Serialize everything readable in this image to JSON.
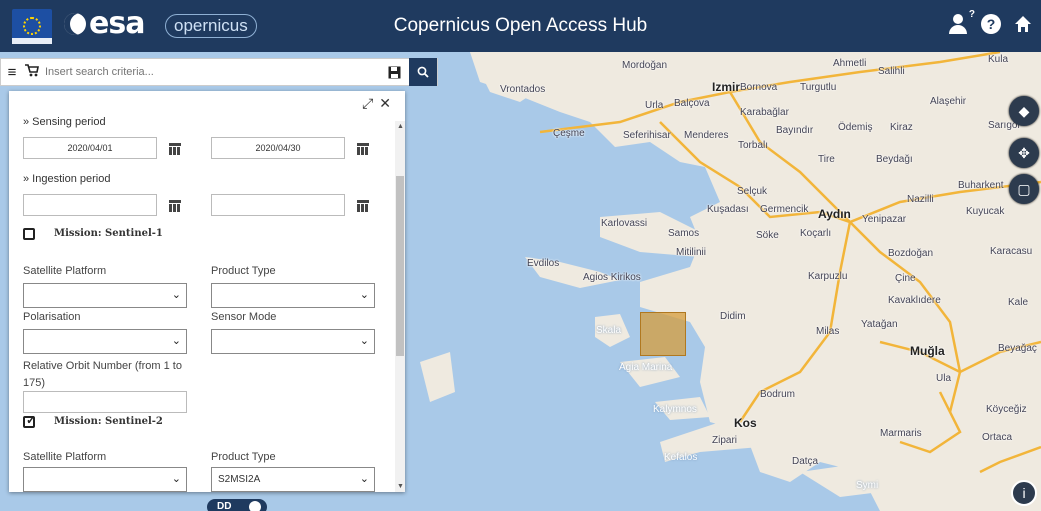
{
  "header": {
    "eu_logo": "eu-flag-icon",
    "esa_logo": "esa",
    "copernicus_logo": "opernicus",
    "title": "Copernicus Open Access Hub"
  },
  "search": {
    "placeholder": "Insert search criteria..."
  },
  "panel": {
    "sensing_period": {
      "label": "» Sensing period",
      "from": "2020/04/01",
      "to": "2020/04/30"
    },
    "ingestion_period": {
      "label": "» Ingestion period",
      "from": "",
      "to": ""
    },
    "sentinel1": {
      "label": "Mission: Sentinel-1",
      "checked": false,
      "satellite_platform_label": "Satellite Platform",
      "satellite_platform_value": "",
      "product_type_label": "Product Type",
      "product_type_value": "",
      "polarisation_label": "Polarisation",
      "polarisation_value": "",
      "sensor_mode_label": "Sensor Mode",
      "sensor_mode_value": "",
      "orbit_label": "Relative Orbit Number (from 1 to 175)",
      "orbit_value": ""
    },
    "sentinel2": {
      "label": "Mission: Sentinel-2",
      "checked": true,
      "satellite_platform_label": "Satellite Platform",
      "satellite_platform_value": "",
      "product_type_label": "Product Type",
      "product_type_value": "S2MSI2A"
    }
  },
  "toggle": {
    "label": "DD"
  },
  "map": {
    "labels": {
      "izmir": "Izmir",
      "bornova": "Bornova",
      "karabaglar": "Karabağlar",
      "mordogan": "Mordoğan",
      "vrontados": "Vrontados",
      "cesme": "Çeşme",
      "urla": "Urla",
      "balcova": "Balçova",
      "seferihisar": "Seferihisar",
      "menderes": "Menderes",
      "torbali": "Torbalı",
      "turgutlu": "Turgutlu",
      "ahmetli": "Ahmetli",
      "salihli": "Salihli",
      "kula": "Kula",
      "alasehir": "Alaşehir",
      "bayindir": "Bayındır",
      "odemis": "Ödemiş",
      "kiraz": "Kiraz",
      "sarigol": "Sarıgöl",
      "tire": "Tire",
      "beydagi": "Beydağı",
      "buharkent": "Buharkent",
      "nazilli": "Nazilli",
      "kuyucak": "Kuyucak",
      "selcuk": "Selçuk",
      "kusadasi": "Kuşadası",
      "germencik": "Germencik",
      "aydin": "Aydın",
      "yenipazar": "Yenipazar",
      "karlovassi": "Karlovassi",
      "samos": "Samos",
      "mitilinii": "Mitilinii",
      "soke": "Söke",
      "kocarli": "Koçarlı",
      "bozdogan": "Bozdoğan",
      "karacasu": "Karacasu",
      "evdilos": "Evdilos",
      "agios_kirikos": "Agios Kirikos",
      "karpuzlu": "Karpuzlu",
      "cine": "Çine",
      "kavaklidere": "Kavaklıdere",
      "kale": "Kale",
      "skala": "Skala",
      "didim": "Didim",
      "milas": "Milas",
      "yatagan": "Yatağan",
      "mugla": "Muğla",
      "beyagac": "Beyağaç",
      "agia_marina": "Agia Marina",
      "ula": "Ula",
      "bodrum": "Bodrum",
      "koycegiz": "Köyceğiz",
      "kalymnos": "Kalymnos",
      "kos": "Kos",
      "zipari": "Zipari",
      "marmaris": "Marmaris",
      "ortaca": "Ortaca",
      "kefalos": "Kefalos",
      "datca": "Datça",
      "symi": "Symi"
    }
  },
  "colors": {
    "header_bg": "#1f3a5f",
    "sea": "#a9c9e8",
    "land": "#efeae0",
    "aoi": "#d69c3c",
    "road": "#f2b53a"
  }
}
